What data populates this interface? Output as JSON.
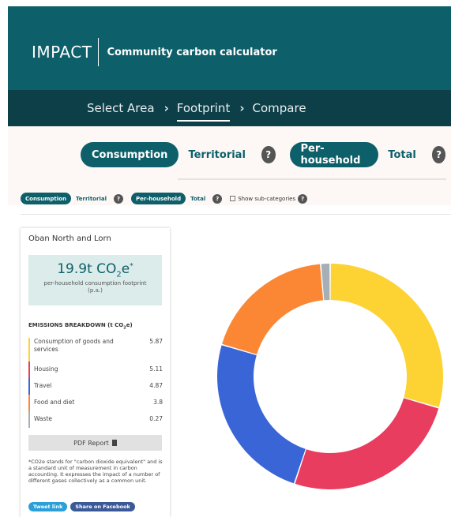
{
  "brand": {
    "name": "IMPACT",
    "subtitle": "Community carbon calculator"
  },
  "steps": [
    {
      "label": "Select Area"
    },
    {
      "label": "Footprint",
      "active": true
    },
    {
      "label": "Compare"
    }
  ],
  "toggles": {
    "consumption": "Consumption",
    "territorial": "Territorial",
    "per_household": "Per-household",
    "total": "Total",
    "help": "?",
    "subcategories": "Show sub-categories"
  },
  "area": {
    "name": "Oban North and Lorn",
    "footprint_value": "19.9t CO",
    "footprint_sub": "2",
    "footprint_unit": "e",
    "footprint_mark": "*",
    "footprint_desc": "per-household consumption footprint (p.a.)"
  },
  "breakdown": {
    "title": "EMISSIONS BREAKDOWN (t CO",
    "title_sub": "2",
    "title_end": "e)",
    "items": [
      {
        "label": "Consumption of goods and services",
        "value": "5.87",
        "color": "#fdd233"
      },
      {
        "label": "Housing",
        "value": "5.11",
        "color": "#e83d5f"
      },
      {
        "label": "Travel",
        "value": "4.87",
        "color": "#3a65d6"
      },
      {
        "label": "Food and diet",
        "value": "3.8",
        "color": "#fb8735"
      },
      {
        "label": "Waste",
        "value": "0.27",
        "color": "#a6aeb6"
      }
    ]
  },
  "pdf_button": "PDF Report",
  "footnote": "*CO2e stands for \"carbon dioxide equivalent\" and is a standard unit of measurement in carbon accounting. It expresses the impact of a number of different gases collectively as a common unit.",
  "share": {
    "tweet": "Tweet link",
    "facebook": "Share on Facebook"
  },
  "colors": {
    "primary": "#0d5f6a",
    "dark": "#0c3f47"
  },
  "chart_data": {
    "type": "pie",
    "donut": true,
    "categories": [
      "Consumption of goods and services",
      "Housing",
      "Travel",
      "Food and diet",
      "Waste"
    ],
    "values": [
      5.87,
      5.11,
      4.87,
      3.8,
      0.27
    ],
    "colors": [
      "#fdd233",
      "#e83d5f",
      "#3a65d6",
      "#fb8735",
      "#a6aeb6"
    ]
  }
}
